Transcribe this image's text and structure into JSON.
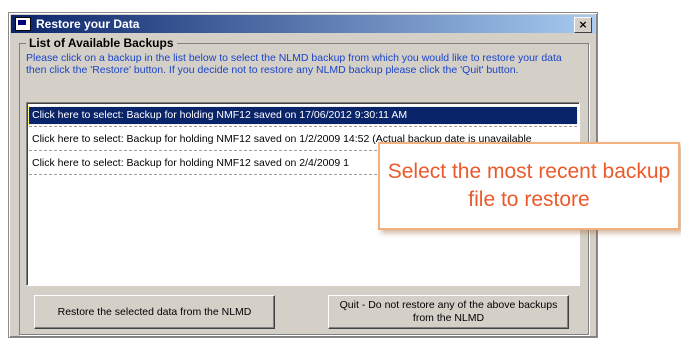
{
  "window": {
    "title": "Restore your Data",
    "close_label": "×"
  },
  "group": {
    "legend": "List of Available Backups",
    "instructions": "Please click on a backup in the list below to select the NLMD backup from which you would like to restore your data then click the 'Restore' button. If you decide not to restore any NLMD backup please click the 'Quit' button."
  },
  "backups": [
    {
      "label": "Click here to select: Backup for holding NMF12 saved on 17/06/2012 9:30:11 AM",
      "selected": true
    },
    {
      "label": "Click here to select: Backup for holding NMF12 saved on  1/2/2009 14:52 (Actual backup date is unavailable",
      "selected": false
    },
    {
      "label": "Click here to select: Backup for holding NMF12 saved on 2/4/2009 1",
      "selected": false
    }
  ],
  "buttons": {
    "restore": "Restore the selected data from the NLMD",
    "quit": "Quit - Do not restore any of the above backups from the NLMD"
  },
  "callout": {
    "text": "Select the most recent backup file to restore"
  },
  "colors": {
    "titlebar": "#0a246a",
    "instructions": "#1a44c8",
    "callout_text": "#ea5a2a",
    "selection": "#0a246a"
  }
}
